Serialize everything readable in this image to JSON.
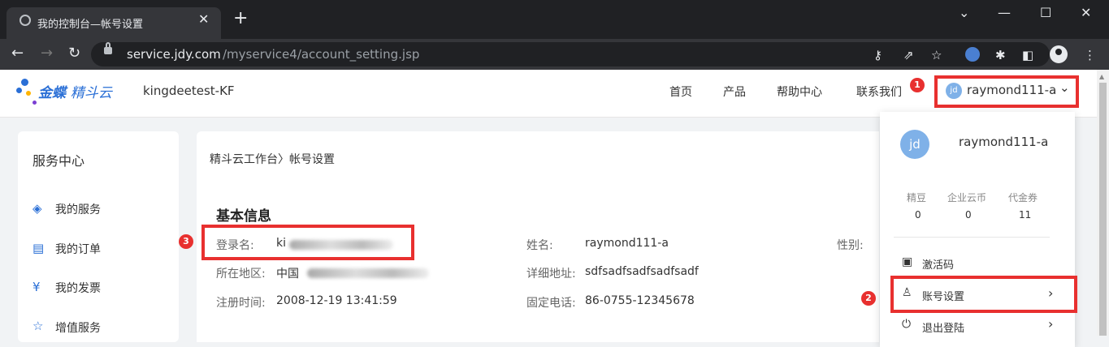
{
  "browser": {
    "tab_title": "我的控制台—帐号设置",
    "tab_close": "✕",
    "new_tab": "+",
    "url_host": "service.jdy.com",
    "url_path": "/myservice4/account_setting.jsp",
    "window_controls": [
      "⌄",
      "—",
      "☐",
      "✕"
    ]
  },
  "header": {
    "logo_brand": "金蝶",
    "logo_product": "精斗云",
    "tenant": "kingdeetest-KF",
    "nav": [
      "首页",
      "产品",
      "帮助中心",
      "联系我们"
    ],
    "user": {
      "avatar_text": "jd",
      "name": "raymond111-a"
    }
  },
  "sidebar": {
    "title": "服务中心",
    "items": [
      {
        "label": "我的服务",
        "icon": "layers-icon"
      },
      {
        "label": "我的订单",
        "icon": "order-icon"
      },
      {
        "label": "我的发票",
        "icon": "invoice-icon"
      },
      {
        "label": "增值服务",
        "icon": "star-icon"
      }
    ]
  },
  "main": {
    "breadcrumb_root": "精斗云工作台",
    "breadcrumb_sep": "〉",
    "breadcrumb_current": "帐号设置",
    "section_title": "基本信息",
    "fields": {
      "login_label": "登录名:",
      "login_value": "ki",
      "name_label": "姓名:",
      "name_value": "raymond111-a",
      "gender_label": "性别:",
      "region_label": "所在地区:",
      "region_value": "中国",
      "address_label": "详细地址:",
      "address_value": "sdfsadfsadfsadfsadf",
      "reg_label": "注册时间:",
      "reg_value": "2008-12-19 13:41:59",
      "phone_label": "固定电话:",
      "phone_value": "86-0755-12345678"
    }
  },
  "dropdown": {
    "avatar_text": "jd",
    "name": "raymond111-a",
    "stats": [
      {
        "label": "精豆",
        "value": "0"
      },
      {
        "label": "企业云币",
        "value": "0"
      },
      {
        "label": "代金券",
        "value": "11"
      }
    ],
    "items": [
      {
        "label": "激活码"
      },
      {
        "label": "账号设置"
      },
      {
        "label": "退出登陆"
      }
    ]
  },
  "annotations": {
    "badge1": "1",
    "badge2": "2",
    "badge3": "3"
  },
  "colors": {
    "accent": "#2a6fd6",
    "highlight": "#e8302f",
    "chrome": "#202124"
  }
}
